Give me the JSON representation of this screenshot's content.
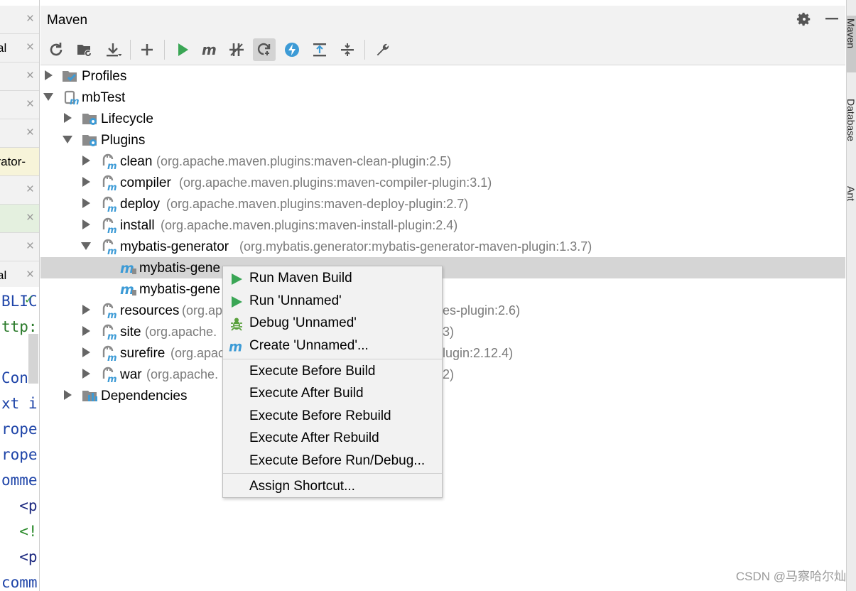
{
  "left_tabs": [
    {
      "label": "",
      "close": "×"
    },
    {
      "label": "al",
      "close": "×"
    },
    {
      "label": "",
      "close": "×"
    },
    {
      "label": "",
      "close": "×"
    },
    {
      "label": "",
      "close": "×"
    },
    {
      "label": "erator-",
      "close": ""
    },
    {
      "label": "",
      "close": "×"
    },
    {
      "label": "",
      "close": "×"
    },
    {
      "label": "",
      "close": "×"
    },
    {
      "label": "al",
      "close": "×"
    }
  ],
  "code_lines": [
    "BLIC",
    "ttp:",
    "",
    "Conf",
    "xt i",
    "rope",
    "rope",
    "omme",
    "  <p",
    "  <!",
    "  <p",
    "comm"
  ],
  "maven": {
    "title": "Maven",
    "settings_icon": "gear-icon",
    "minimize_icon": "minimize-icon"
  },
  "toolbar": [
    {
      "icon": "reload-icon"
    },
    {
      "icon": "generate-sources-icon"
    },
    {
      "icon": "download-icon"
    },
    {
      "icon": "add-icon"
    },
    {
      "icon": "run-icon"
    },
    {
      "icon": "execute-goal-icon"
    },
    {
      "icon": "toggle-offline-icon"
    },
    {
      "icon": "skip-tests-icon"
    },
    {
      "icon": "show-dependencies-icon"
    },
    {
      "icon": "expand-all-icon"
    },
    {
      "icon": "collapse-all-icon"
    },
    {
      "icon": "settings-wrench-icon"
    }
  ],
  "tree": [
    {
      "label": "Profiles",
      "sub": "",
      "icon": "profiles-icon"
    },
    {
      "label": "mbTest",
      "sub": "",
      "icon": "maven-project-icon"
    },
    {
      "label": "Lifecycle",
      "sub": "",
      "icon": "lifecycle-folder-icon"
    },
    {
      "label": "Plugins",
      "sub": "",
      "icon": "plugins-folder-icon"
    },
    {
      "label": "clean",
      "sub": "(org.apache.maven.plugins:maven-clean-plugin:2.5)",
      "icon": "plugin-icon"
    },
    {
      "label": "compiler",
      "sub": "(org.apache.maven.plugins:maven-compiler-plugin:3.1)",
      "icon": "plugin-icon"
    },
    {
      "label": "deploy",
      "sub": "(org.apache.maven.plugins:maven-deploy-plugin:2.7)",
      "icon": "plugin-icon"
    },
    {
      "label": "install",
      "sub": "(org.apache.maven.plugins:maven-install-plugin:2.4)",
      "icon": "plugin-icon"
    },
    {
      "label": "mybatis-generator",
      "sub": "(org.mybatis.generator:mybatis-generator-maven-plugin:1.3.7)",
      "icon": "plugin-icon"
    },
    {
      "label": "mybatis-gene",
      "sub": "",
      "icon": "goal-icon"
    },
    {
      "label": "mybatis-gene",
      "sub": "",
      "icon": "goal-icon"
    },
    {
      "label": "resources",
      "sub": "(org.ap",
      "sub2": "es-plugin:2.6)",
      "icon": "plugin-icon"
    },
    {
      "label": "site",
      "sub": "(org.apache.",
      "sub2": "3)",
      "icon": "plugin-icon"
    },
    {
      "label": "surefire",
      "sub": "(org.apac",
      "sub2": "lugin:2.12.4)",
      "icon": "plugin-icon"
    },
    {
      "label": "war",
      "sub": "(org.apache.",
      "sub2": "2)",
      "icon": "plugin-icon"
    },
    {
      "label": "Dependencies",
      "sub": "",
      "icon": "dependencies-icon"
    }
  ],
  "context_menu": {
    "items": [
      {
        "label": "Run Maven Build",
        "icon": "run-icon"
      },
      {
        "label": "Run 'Unnamed'",
        "icon": "run-icon"
      },
      {
        "label": "Debug 'Unnamed'",
        "icon": "debug-bug-icon"
      },
      {
        "label": "Create 'Unnamed'...",
        "icon": "maven-m-icon"
      },
      {
        "label": "Execute Before Build",
        "icon": ""
      },
      {
        "label": "Execute After Build",
        "icon": ""
      },
      {
        "label": "Execute Before Rebuild",
        "icon": ""
      },
      {
        "label": "Execute After Rebuild",
        "icon": ""
      },
      {
        "label": "Execute Before Run/Debug...",
        "icon": ""
      },
      {
        "label": "Assign Shortcut...",
        "icon": ""
      }
    ]
  },
  "right_tabs": [
    {
      "label": "Maven"
    },
    {
      "label": "Database"
    },
    {
      "label": "Ant"
    }
  ],
  "watermark": "CSDN @马察哈尔灿",
  "colors": {
    "run_green": "#3aa655",
    "maven_blue": "#3d9bd6",
    "debug_green": "#5aa03c",
    "selection": "#d5d5d5"
  }
}
